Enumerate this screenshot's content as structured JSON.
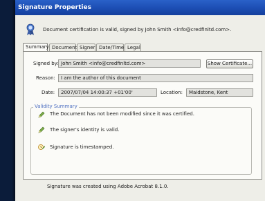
{
  "window": {
    "title": "Signature Properties"
  },
  "header": {
    "message": "Document certification is valid, signed by John Smith <info@credfinltd.com>."
  },
  "tabs": [
    {
      "label": "Summary"
    },
    {
      "label": "Document"
    },
    {
      "label": "Signer"
    },
    {
      "label": "Date/Time"
    },
    {
      "label": "Legal"
    }
  ],
  "summary": {
    "signed_by_label": "Signed by:",
    "signed_by_value": "John Smith <info@credfinltd.com>",
    "show_certificate_button": "Show Certificate...",
    "reason_label": "Reason:",
    "reason_value": "I am the author of this document",
    "date_label": "Date:",
    "date_value": "2007/07/04 14:00:37 +01'00'",
    "location_label": "Location:",
    "location_value": "Maidstone, Kent"
  },
  "validity": {
    "title": "Validity Summary",
    "items": [
      {
        "icon": "pen-check-icon",
        "text": "The Document has not been modified since it was certified."
      },
      {
        "icon": "pen-check-icon",
        "text": "The signer's identity is valid."
      },
      {
        "icon": "clock-pen-icon",
        "text": "Signature is timestamped."
      }
    ]
  },
  "footer": {
    "text": "Signature was created using Adobe Acrobat 8.1.0."
  },
  "colors": {
    "titlebar": "#1d4fb5",
    "panel": "#fbfbf8",
    "group_title": "#4b6dc0"
  }
}
